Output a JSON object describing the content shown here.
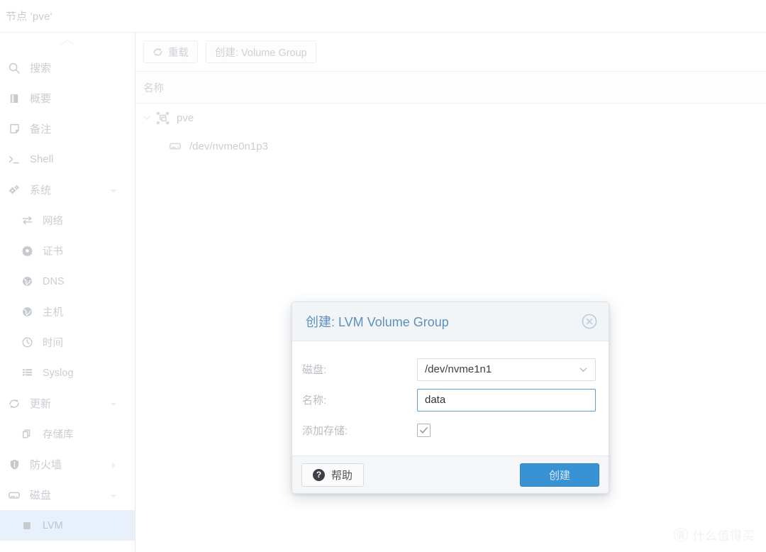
{
  "titlebar": {
    "text": "节点 'pve'"
  },
  "sidebar": {
    "collapse_icon": "chevron-up-icon",
    "items": [
      {
        "label": "搜索",
        "icon": "search-icon",
        "level": 0,
        "arrow": "none",
        "selected": false
      },
      {
        "label": "概要",
        "icon": "book-icon",
        "level": 0,
        "arrow": "none",
        "selected": false
      },
      {
        "label": "备注",
        "icon": "note-icon",
        "level": 0,
        "arrow": "none",
        "selected": false
      },
      {
        "label": "Shell",
        "icon": "terminal-icon",
        "level": 0,
        "arrow": "none",
        "selected": false
      },
      {
        "label": "系统",
        "icon": "gears-icon",
        "level": 0,
        "arrow": "down",
        "selected": false
      },
      {
        "label": "网络",
        "icon": "network-icon",
        "level": 1,
        "arrow": "none",
        "selected": false
      },
      {
        "label": "证书",
        "icon": "certificate-icon",
        "level": 1,
        "arrow": "none",
        "selected": false
      },
      {
        "label": "DNS",
        "icon": "globe-icon",
        "level": 1,
        "arrow": "none",
        "selected": false
      },
      {
        "label": "主机",
        "icon": "globe-icon",
        "level": 1,
        "arrow": "none",
        "selected": false
      },
      {
        "label": "时间",
        "icon": "clock-icon",
        "level": 1,
        "arrow": "none",
        "selected": false
      },
      {
        "label": "Syslog",
        "icon": "list-icon",
        "level": 1,
        "arrow": "none",
        "selected": false
      },
      {
        "label": "更新",
        "icon": "refresh-icon",
        "level": 0,
        "arrow": "down",
        "selected": false
      },
      {
        "label": "存储库",
        "icon": "copy-icon",
        "level": 1,
        "arrow": "none",
        "selected": false
      },
      {
        "label": "防火墙",
        "icon": "shield-icon",
        "level": 0,
        "arrow": "right",
        "selected": false
      },
      {
        "label": "磁盘",
        "icon": "disk-icon",
        "level": 0,
        "arrow": "down",
        "selected": false
      },
      {
        "label": "LVM",
        "icon": "square-icon",
        "level": 1,
        "arrow": "none",
        "selected": true
      }
    ]
  },
  "main": {
    "toolbar": {
      "reload_label": "重载",
      "reload_icon": "refresh-icon",
      "create_label": "创建: Volume Group"
    },
    "grid": {
      "columns": [
        "名称"
      ],
      "rows": [
        {
          "label": "pve",
          "icon": "cluster-icon",
          "depth": 0,
          "twisty": "chevron-down-icon"
        },
        {
          "label": "/dev/nvme0n1p3",
          "icon": "disk-icon",
          "depth": 1,
          "twisty": "none"
        }
      ]
    }
  },
  "watermark": {
    "badge": "值",
    "text": "什么值得买"
  },
  "dialog": {
    "title": "创建: LVM Volume Group",
    "close_icon": "close-circle-icon",
    "fields": {
      "disk_label": "磁盘:",
      "disk_value": "/dev/nvme1n1",
      "disk_caret_icon": "chevron-down-icon",
      "name_label": "名称:",
      "name_value": "data",
      "name_placeholder": "",
      "storage_label": "添加存储:",
      "storage_checked": true
    },
    "footer": {
      "help_label": "帮助",
      "help_icon": "question-circle-icon",
      "create_label": "创建"
    }
  },
  "colors": {
    "accent_blue": "#3892d4",
    "title_blue": "#5c90bf",
    "selected_row": "#e8f1fb",
    "focus_border": "#5a9fd4"
  }
}
